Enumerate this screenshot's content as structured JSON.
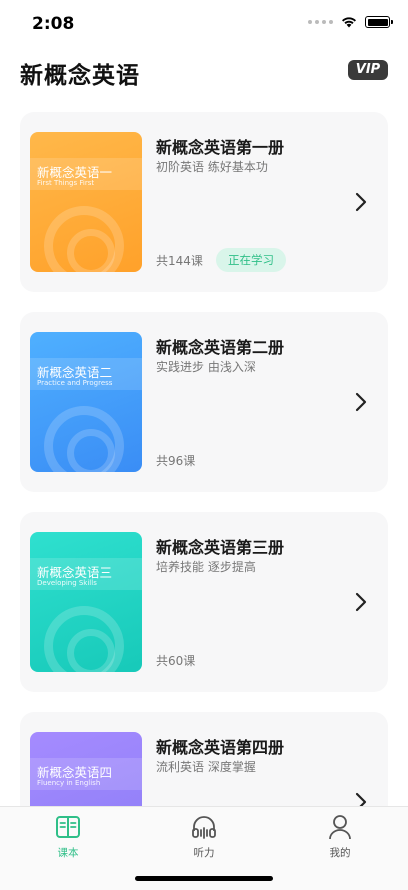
{
  "status_bar": {
    "time": "2:08"
  },
  "header": {
    "title": "新概念英语",
    "vip_label": "VIP"
  },
  "courses": [
    {
      "cover_title": "新概念英语一",
      "cover_subtitle": "First Things First",
      "title": "新概念英语第一册",
      "description": "初阶英语 练好基本功",
      "count": "共144课",
      "status": "正在学习"
    },
    {
      "cover_title": "新概念英语二",
      "cover_subtitle": "Practice and Progress",
      "title": "新概念英语第二册",
      "description": "实践进步 由浅入深",
      "count": "共96课"
    },
    {
      "cover_title": "新概念英语三",
      "cover_subtitle": "Developing Skills",
      "title": "新概念英语第三册",
      "description": "培养技能 逐步提高",
      "count": "共60课"
    },
    {
      "cover_title": "新概念英语四",
      "cover_subtitle": "Fluency in English",
      "title": "新概念英语第四册",
      "description": "流利英语 深度掌握"
    }
  ],
  "tabs": [
    {
      "label": "课本",
      "icon": "book-icon",
      "active": true
    },
    {
      "label": "听力",
      "icon": "headphones-icon",
      "active": false
    },
    {
      "label": "我的",
      "icon": "person-icon",
      "active": false
    }
  ],
  "colors": {
    "accent": "#2fbf88",
    "cover_1": "#ffa12a",
    "cover_2": "#3a8df5",
    "cover_3": "#17c9b9",
    "cover_4": "#8a7cf5"
  }
}
